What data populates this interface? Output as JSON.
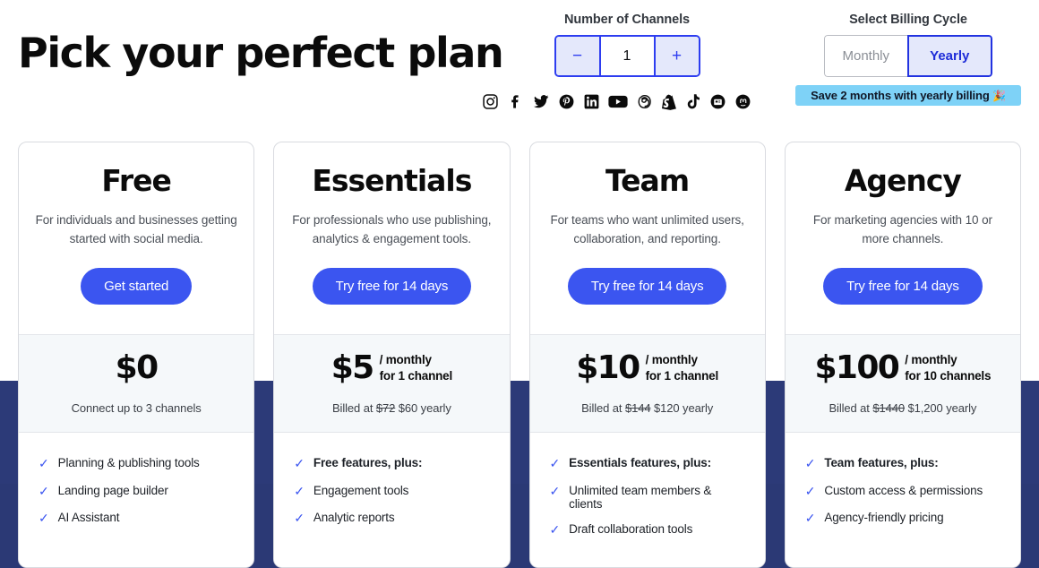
{
  "page_title": "Pick your perfect plan",
  "controls": {
    "channels": {
      "label": "Number of Channels",
      "decrement": "−",
      "value": "1",
      "increment": "+"
    },
    "billing": {
      "label": "Select Billing Cycle",
      "options": [
        "Monthly",
        "Yearly"
      ],
      "selected": "Yearly",
      "monthly_label": "Monthly",
      "yearly_label": "Yearly",
      "save_badge": "Save 2 months with yearly billing",
      "save_badge_emoji": "🎉"
    }
  },
  "social_icons": [
    "instagram-icon",
    "facebook-icon",
    "twitter-icon",
    "pinterest-icon",
    "linkedin-icon",
    "youtube-icon",
    "threads-icon",
    "shopify-icon",
    "tiktok-icon",
    "google-business-icon",
    "mastodon-icon"
  ],
  "colors": {
    "accent_blue": "#3b55f0",
    "control_blue": "#2d3df0",
    "navy_band": "#2c3a78",
    "badge_blue": "#7ed2f7",
    "price_band": "#f5f8fa",
    "check_blue": "#3b55f0"
  },
  "plans": [
    {
      "name": "Free",
      "description": "For individuals and businesses getting started with social media.",
      "cta": "Get started",
      "price_amount": "$0",
      "price_unit_line1": "",
      "price_unit_line2": "",
      "billed_note_prefix": "Connect up to 3 channels",
      "billed_strike": "",
      "billed_new": "",
      "billed_suffix": "",
      "features": [
        {
          "text": "Planning & publishing tools",
          "bold": false
        },
        {
          "text": "Landing page builder",
          "bold": false
        },
        {
          "text": "AI Assistant",
          "bold": false
        }
      ]
    },
    {
      "name": "Essentials",
      "description": "For professionals who use publishing, analytics & engagement tools.",
      "cta": "Try free for 14 days",
      "price_amount": "$5",
      "price_unit_line1": "/ monthly",
      "price_unit_line2": "for 1 channel",
      "billed_note_prefix": "Billed at ",
      "billed_strike": "$72",
      "billed_new": "$60",
      "billed_suffix": " yearly",
      "features": [
        {
          "text": "Free features, plus:",
          "bold": true
        },
        {
          "text": "Engagement tools",
          "bold": false
        },
        {
          "text": "Analytic reports",
          "bold": false
        }
      ]
    },
    {
      "name": "Team",
      "description": "For teams who want unlimited users, collaboration, and reporting.",
      "cta": "Try free for 14 days",
      "price_amount": "$10",
      "price_unit_line1": "/ monthly",
      "price_unit_line2": "for 1 channel",
      "billed_note_prefix": "Billed at ",
      "billed_strike": "$144",
      "billed_new": "$120",
      "billed_suffix": " yearly",
      "features": [
        {
          "text": "Essentials features, plus:",
          "bold": true
        },
        {
          "text": "Unlimited team members & clients",
          "bold": false
        },
        {
          "text": "Draft collaboration tools",
          "bold": false
        }
      ]
    },
    {
      "name": "Agency",
      "description": "For marketing agencies with 10 or more channels.",
      "cta": "Try free for 14 days",
      "price_amount": "$100",
      "price_unit_line1": "/ monthly",
      "price_unit_line2": "for 10 channels",
      "billed_note_prefix": "Billed at ",
      "billed_strike": "$1440",
      "billed_new": "$1,200",
      "billed_suffix": " yearly",
      "features": [
        {
          "text": "Team features, plus:",
          "bold": true
        },
        {
          "text": "Custom access & permissions",
          "bold": false
        },
        {
          "text": "Agency-friendly pricing",
          "bold": false
        }
      ]
    }
  ]
}
